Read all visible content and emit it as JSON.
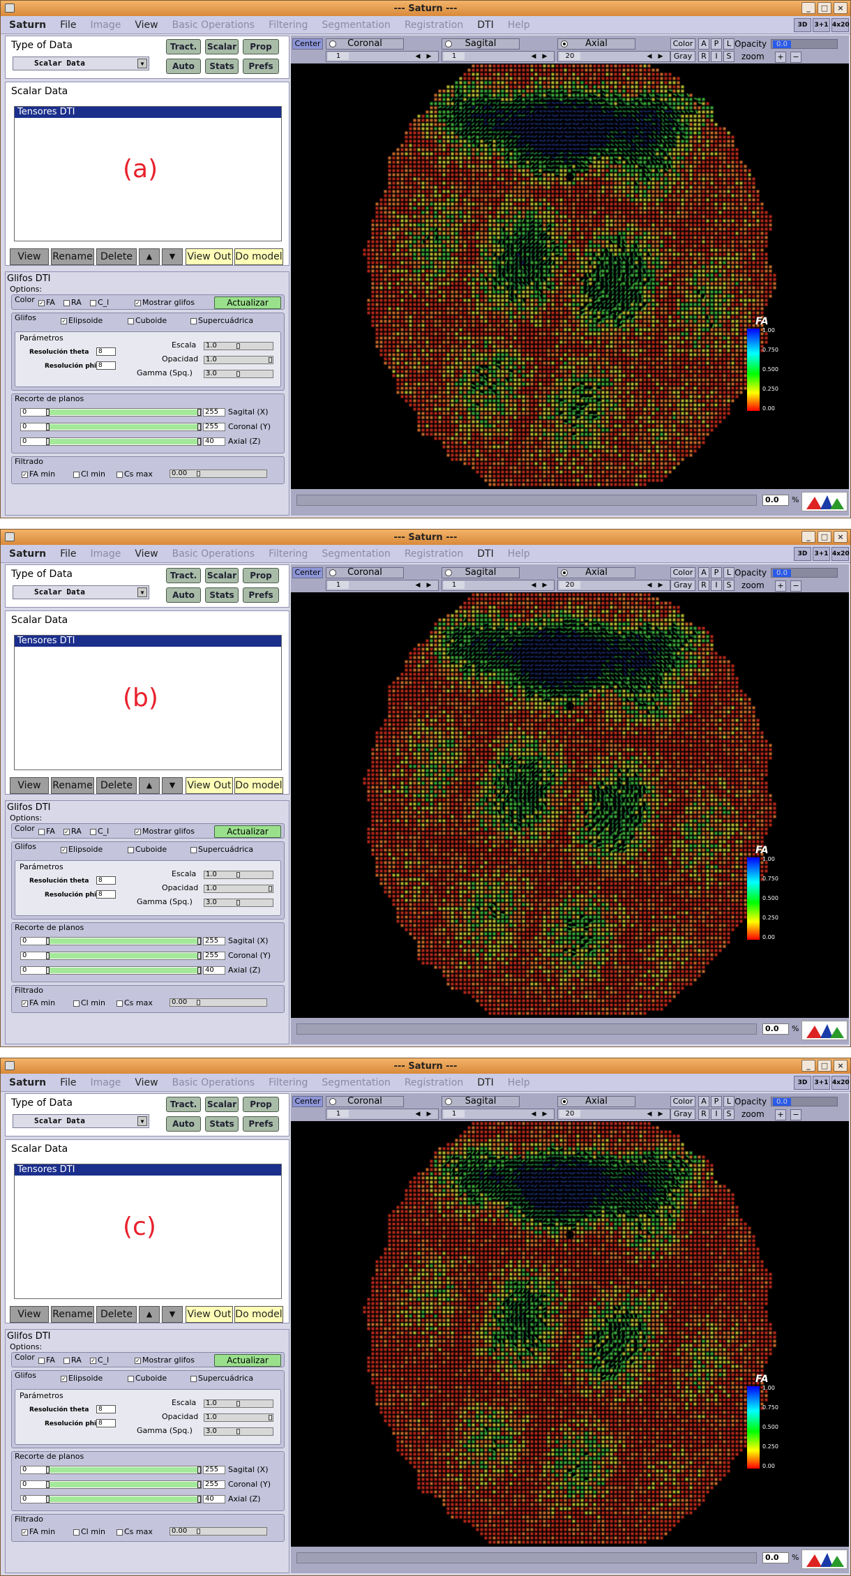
{
  "window_title": "--- Saturn ---",
  "window_buttons": [
    "_",
    "□",
    "×"
  ],
  "menu": [
    "Saturn",
    "File",
    "Image",
    "View",
    "Basic Operations",
    "Filtering",
    "Segmentation",
    "Registration",
    "DTI",
    "Help"
  ],
  "view_buttons": [
    "3D",
    "3+1",
    "4x20"
  ],
  "type_of_data": {
    "title": "Type of Data",
    "selected": "Scalar Data",
    "buttons": [
      "Tract.",
      "Scalar",
      "Prop",
      "Auto",
      "Stats",
      "Prefs"
    ]
  },
  "scalar_data": {
    "title": "Scalar Data",
    "items": [
      "Tensores DTI"
    ],
    "buttons": [
      "View",
      "Rename",
      "Delete",
      "▲",
      "▼",
      "View Out",
      "Do model"
    ]
  },
  "glifos": {
    "title": "Glifos DTI",
    "options_label": "Options:",
    "color_label": "Color",
    "color_options": [
      "FA",
      "RA",
      "C_l"
    ],
    "mostrar": "Mostrar glifos",
    "actualizar": "Actualizar",
    "glifos_label": "Glifos",
    "glifo_types": [
      "Elipsoide",
      "Cuboide",
      "Supercuádrica"
    ],
    "parametros": "Parámetros",
    "res_theta": "Resolución theta",
    "res_phi": "Resolución phi",
    "res_theta_val": "8",
    "res_phi_val": "8",
    "escala": "Escala",
    "opacidad": "Opacidad",
    "gamma": "Gamma (Spq.)",
    "escala_val": "1.0",
    "opacidad_val": "1.0",
    "gamma_val": "3.0",
    "recorte": "Recorte de planos",
    "planes": [
      {
        "min": "0",
        "max": "255",
        "label": "Sagital (X)"
      },
      {
        "min": "0",
        "max": "255",
        "label": "Coronal (Y)"
      },
      {
        "min": "0",
        "max": "40",
        "label": "Axial (Z)"
      }
    ],
    "filtrado": "Filtrado",
    "filters": [
      "FA min",
      "Cl min",
      "Cs max"
    ],
    "filter_val": "0.00"
  },
  "viewer": {
    "center": "Center",
    "views": [
      "Coronal",
      "Sagital",
      "Axial"
    ],
    "slices": [
      "1",
      "1",
      "20"
    ],
    "color": "Color",
    "gray": "Gray",
    "orient": [
      "A",
      "P",
      "L",
      "R",
      "I",
      "S"
    ],
    "opacity": "Opacity",
    "opacity_val": "0.0",
    "zoom": "zoom",
    "zoom_plus": "+",
    "zoom_minus": "−",
    "percent_val": "0.0",
    "percent": "%",
    "legend_title": "FA",
    "legend_ticks": [
      "1.00",
      "0.750",
      "0.500",
      "0.250",
      "0.00"
    ]
  },
  "panels": [
    {
      "label": "(a)",
      "color_checked": 0
    },
    {
      "label": "(b)",
      "color_checked": 1
    },
    {
      "label": "(c)",
      "color_checked": 2
    }
  ],
  "colors": {
    "label": "#e8212c",
    "selection": "#1a2e8c",
    "titlebar": "#e8a050",
    "menubar": "#cccce6",
    "green_button": "#9ae08c",
    "yellow_button": "#ffffb8"
  }
}
